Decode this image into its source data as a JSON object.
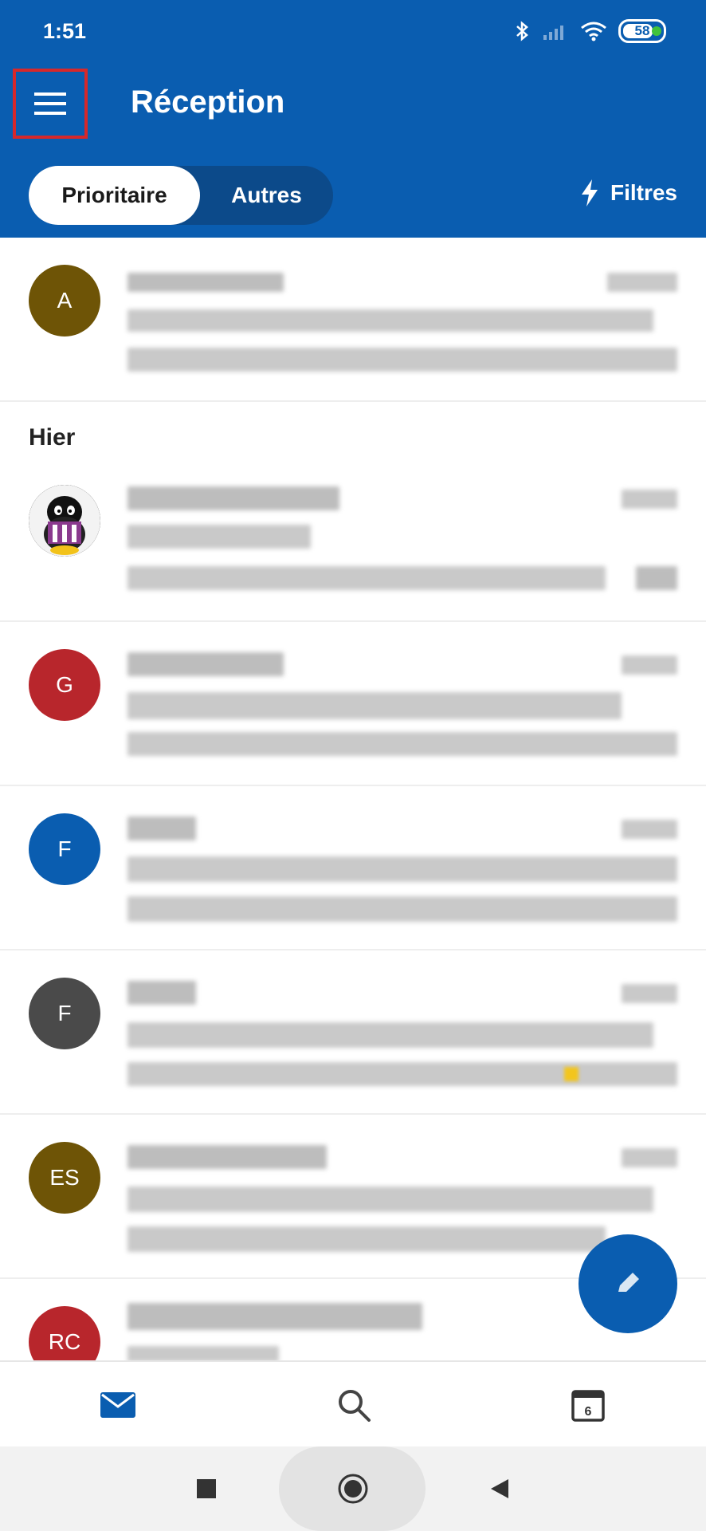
{
  "status_bar": {
    "time": "1:51",
    "battery": "58"
  },
  "header": {
    "title": "Réception",
    "menu_label": "Menu"
  },
  "segments": {
    "focused": "Prioritaire",
    "other": "Autres"
  },
  "filters_label": "Filtres",
  "sections": {
    "yesterday": "Hier"
  },
  "emails": [
    {
      "initials": "A",
      "color": "#6e5406"
    },
    {
      "initials": "",
      "color": "#111111"
    },
    {
      "initials": "G",
      "color": "#b8262c"
    },
    {
      "initials": "F",
      "color": "#0a5db0"
    },
    {
      "initials": "F",
      "color": "#4a4a4a"
    },
    {
      "initials": "ES",
      "color": "#6e5406"
    },
    {
      "initials": "RC",
      "color": "#b8262c"
    }
  ],
  "tabbar": {
    "calendar_day": "6"
  },
  "colors": {
    "brand": "#0a5db0",
    "highlight": "#d6282b"
  }
}
